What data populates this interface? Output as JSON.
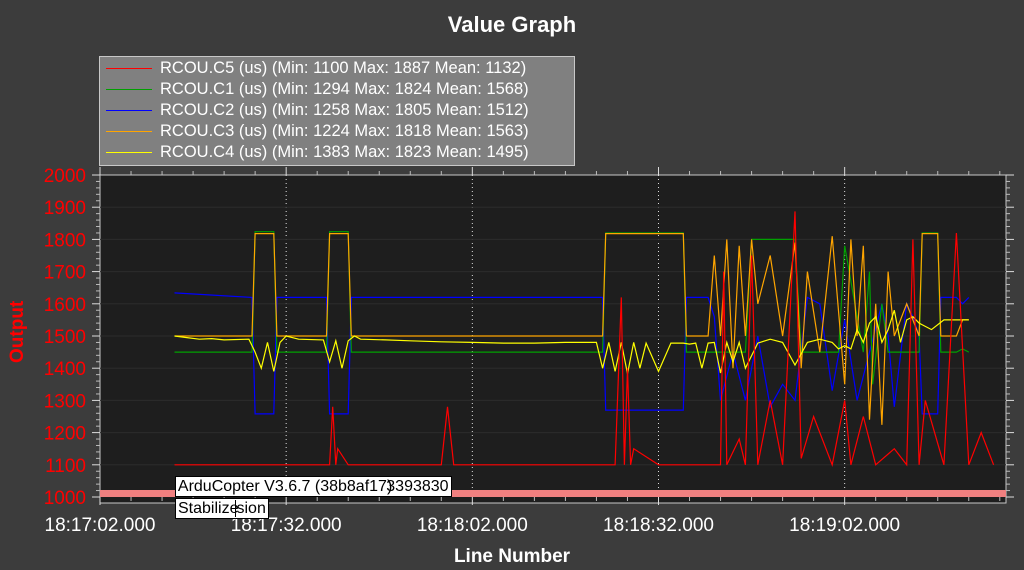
{
  "chart_data": {
    "type": "line",
    "title": "Value Graph",
    "xlabel": "Line Number",
    "ylabel": "Output",
    "ylim": [
      1000,
      2000
    ],
    "y_ticks": [
      "1000",
      "1100",
      "1200",
      "1300",
      "1400",
      "1500",
      "1600",
      "1700",
      "1800",
      "1900",
      "2000"
    ],
    "x_ticks": [
      "18:17:02.000",
      "18:17:32.000",
      "18:18:02.000",
      "18:18:32.000",
      "18:19:02.000"
    ],
    "xlim_seconds": [
      0,
      146
    ],
    "grid": true,
    "legend_position": "top-left",
    "annotations": [
      "ArduCopter V3.6.7 (38b8af17)",
      "0",
      "3393830",
      "Stabilize",
      "sion"
    ],
    "series": [
      {
        "name": "RCOU.C5 (us) (Min: 1100 Max: 1887 Mean: 1132)",
        "color": "#ff0000",
        "x": [
          12,
          37,
          37.5,
          38,
          38.3,
          40,
          50,
          55,
          56,
          57,
          60,
          65,
          70,
          75,
          80,
          83,
          84,
          84.5,
          85,
          85.5,
          86,
          90,
          95,
          100,
          100.5,
          101,
          103,
          104,
          105,
          106,
          108,
          110,
          112,
          113,
          115,
          118,
          120,
          121,
          123,
          125,
          128,
          130,
          131,
          132,
          133,
          136,
          138,
          140,
          142,
          144
        ],
        "values": [
          1100,
          1100,
          1280,
          1100,
          1150,
          1100,
          1100,
          1100,
          1280,
          1100,
          1100,
          1100,
          1100,
          1100,
          1100,
          1100,
          1620,
          1100,
          1400,
          1100,
          1150,
          1100,
          1100,
          1100,
          1700,
          1100,
          1180,
          1100,
          1750,
          1100,
          1300,
          1100,
          1887,
          1120,
          1250,
          1100,
          1300,
          1100,
          1250,
          1100,
          1150,
          1100,
          1800,
          1100,
          1300,
          1100,
          1820,
          1100,
          1200,
          1100
        ]
      },
      {
        "name": "RCOU.C1 (us) (Min: 1294 Max: 1824 Mean: 1568)",
        "color": "#00a000",
        "x": [
          12,
          24.5,
          25,
          28,
          28.5,
          36.5,
          37,
          40,
          40.5,
          81,
          81.5,
          94,
          94.5,
          104,
          105,
          112,
          113,
          119,
          120,
          123,
          124,
          124.5,
          126,
          127,
          132,
          132.5,
          135,
          135.5,
          138,
          139,
          140
        ],
        "values": [
          1450,
          1450,
          1824,
          1824,
          1450,
          1450,
          1824,
          1824,
          1450,
          1450,
          1820,
          1820,
          1450,
          1450,
          1800,
          1800,
          1450,
          1450,
          1780,
          1450,
          1700,
          1350,
          1600,
          1450,
          1450,
          1820,
          1820,
          1450,
          1450,
          1460,
          1450
        ]
      },
      {
        "name": "RCOU.C2 (us) (Min: 1258 Max: 1805 Mean: 1512)",
        "color": "#0000ff",
        "x": [
          12,
          24.5,
          25,
          28,
          28.5,
          36.5,
          37,
          40,
          40.5,
          81,
          81.5,
          94,
          94.5,
          98,
          99,
          100,
          102,
          104,
          106,
          108,
          110,
          112,
          114,
          116,
          118,
          120,
          122,
          124,
          126,
          127,
          128,
          130,
          131,
          132,
          132.5,
          135,
          135.5,
          138,
          139,
          140
        ],
        "values": [
          1634,
          1620,
          1258,
          1258,
          1620,
          1620,
          1258,
          1258,
          1620,
          1620,
          1270,
          1270,
          1620,
          1620,
          1560,
          1300,
          1450,
          1300,
          1500,
          1280,
          1350,
          1300,
          1620,
          1600,
          1330,
          1550,
          1300,
          1450,
          1600,
          1500,
          1280,
          1600,
          1560,
          1500,
          1258,
          1258,
          1620,
          1620,
          1600,
          1620
        ]
      },
      {
        "name": "RCOU.C3 (us) (Min: 1224 Max: 1818 Mean: 1563)",
        "color": "#ffa500",
        "x": [
          12,
          24.5,
          25,
          28,
          28.5,
          36.5,
          37,
          40,
          40.5,
          81,
          81.5,
          94,
          94.5,
          98,
          99,
          100,
          101,
          102,
          103,
          104,
          105,
          106,
          108,
          110,
          112,
          113,
          114,
          116,
          118,
          120,
          121,
          122,
          123,
          124,
          125,
          126,
          127,
          128,
          130,
          132,
          132.5,
          135,
          135.5,
          138,
          139,
          140
        ],
        "values": [
          1500,
          1500,
          1818,
          1818,
          1500,
          1500,
          1818,
          1818,
          1500,
          1500,
          1818,
          1818,
          1500,
          1500,
          1750,
          1500,
          1800,
          1400,
          1780,
          1500,
          1800,
          1600,
          1750,
          1500,
          1790,
          1400,
          1700,
          1450,
          1810,
          1350,
          1800,
          1500,
          1780,
          1240,
          1600,
          1224,
          1700,
          1500,
          1600,
          1500,
          1818,
          1818,
          1500,
          1500,
          1550,
          1550
        ]
      },
      {
        "name": "RCOU.C4 (us) (Min: 1383 Max: 1823 Mean: 1495)",
        "color": "#ffff00",
        "x": [
          12,
          14,
          16,
          18,
          20,
          24,
          25,
          26,
          27,
          28,
          29,
          30,
          32,
          36,
          37,
          38,
          39,
          40,
          41,
          42,
          46,
          50,
          55,
          60,
          65,
          70,
          75,
          80,
          81,
          82,
          83,
          84,
          85,
          86,
          87,
          88,
          90,
          92,
          94,
          95,
          96,
          97,
          98,
          99,
          100,
          101,
          102,
          103,
          104,
          106,
          108,
          110,
          112,
          114,
          116,
          118,
          119,
          120,
          121,
          122,
          123,
          124,
          125,
          126,
          127,
          128,
          129,
          130,
          131,
          132,
          134,
          136,
          138,
          140
        ],
        "values": [
          1500,
          1495,
          1490,
          1492,
          1488,
          1490,
          1450,
          1400,
          1480,
          1390,
          1480,
          1500,
          1490,
          1488,
          1420,
          1485,
          1400,
          1485,
          1500,
          1490,
          1488,
          1485,
          1482,
          1480,
          1478,
          1478,
          1480,
          1480,
          1400,
          1480,
          1390,
          1480,
          1383,
          1480,
          1400,
          1478,
          1390,
          1478,
          1478,
          1475,
          1478,
          1400,
          1478,
          1480,
          1385,
          1480,
          1420,
          1480,
          1400,
          1478,
          1490,
          1480,
          1410,
          1480,
          1490,
          1480,
          1460,
          1470,
          1460,
          1520,
          1480,
          1540,
          1560,
          1480,
          1520,
          1580,
          1480,
          1550,
          1560,
          1540,
          1520,
          1550,
          1550,
          1550
        ]
      }
    ]
  }
}
